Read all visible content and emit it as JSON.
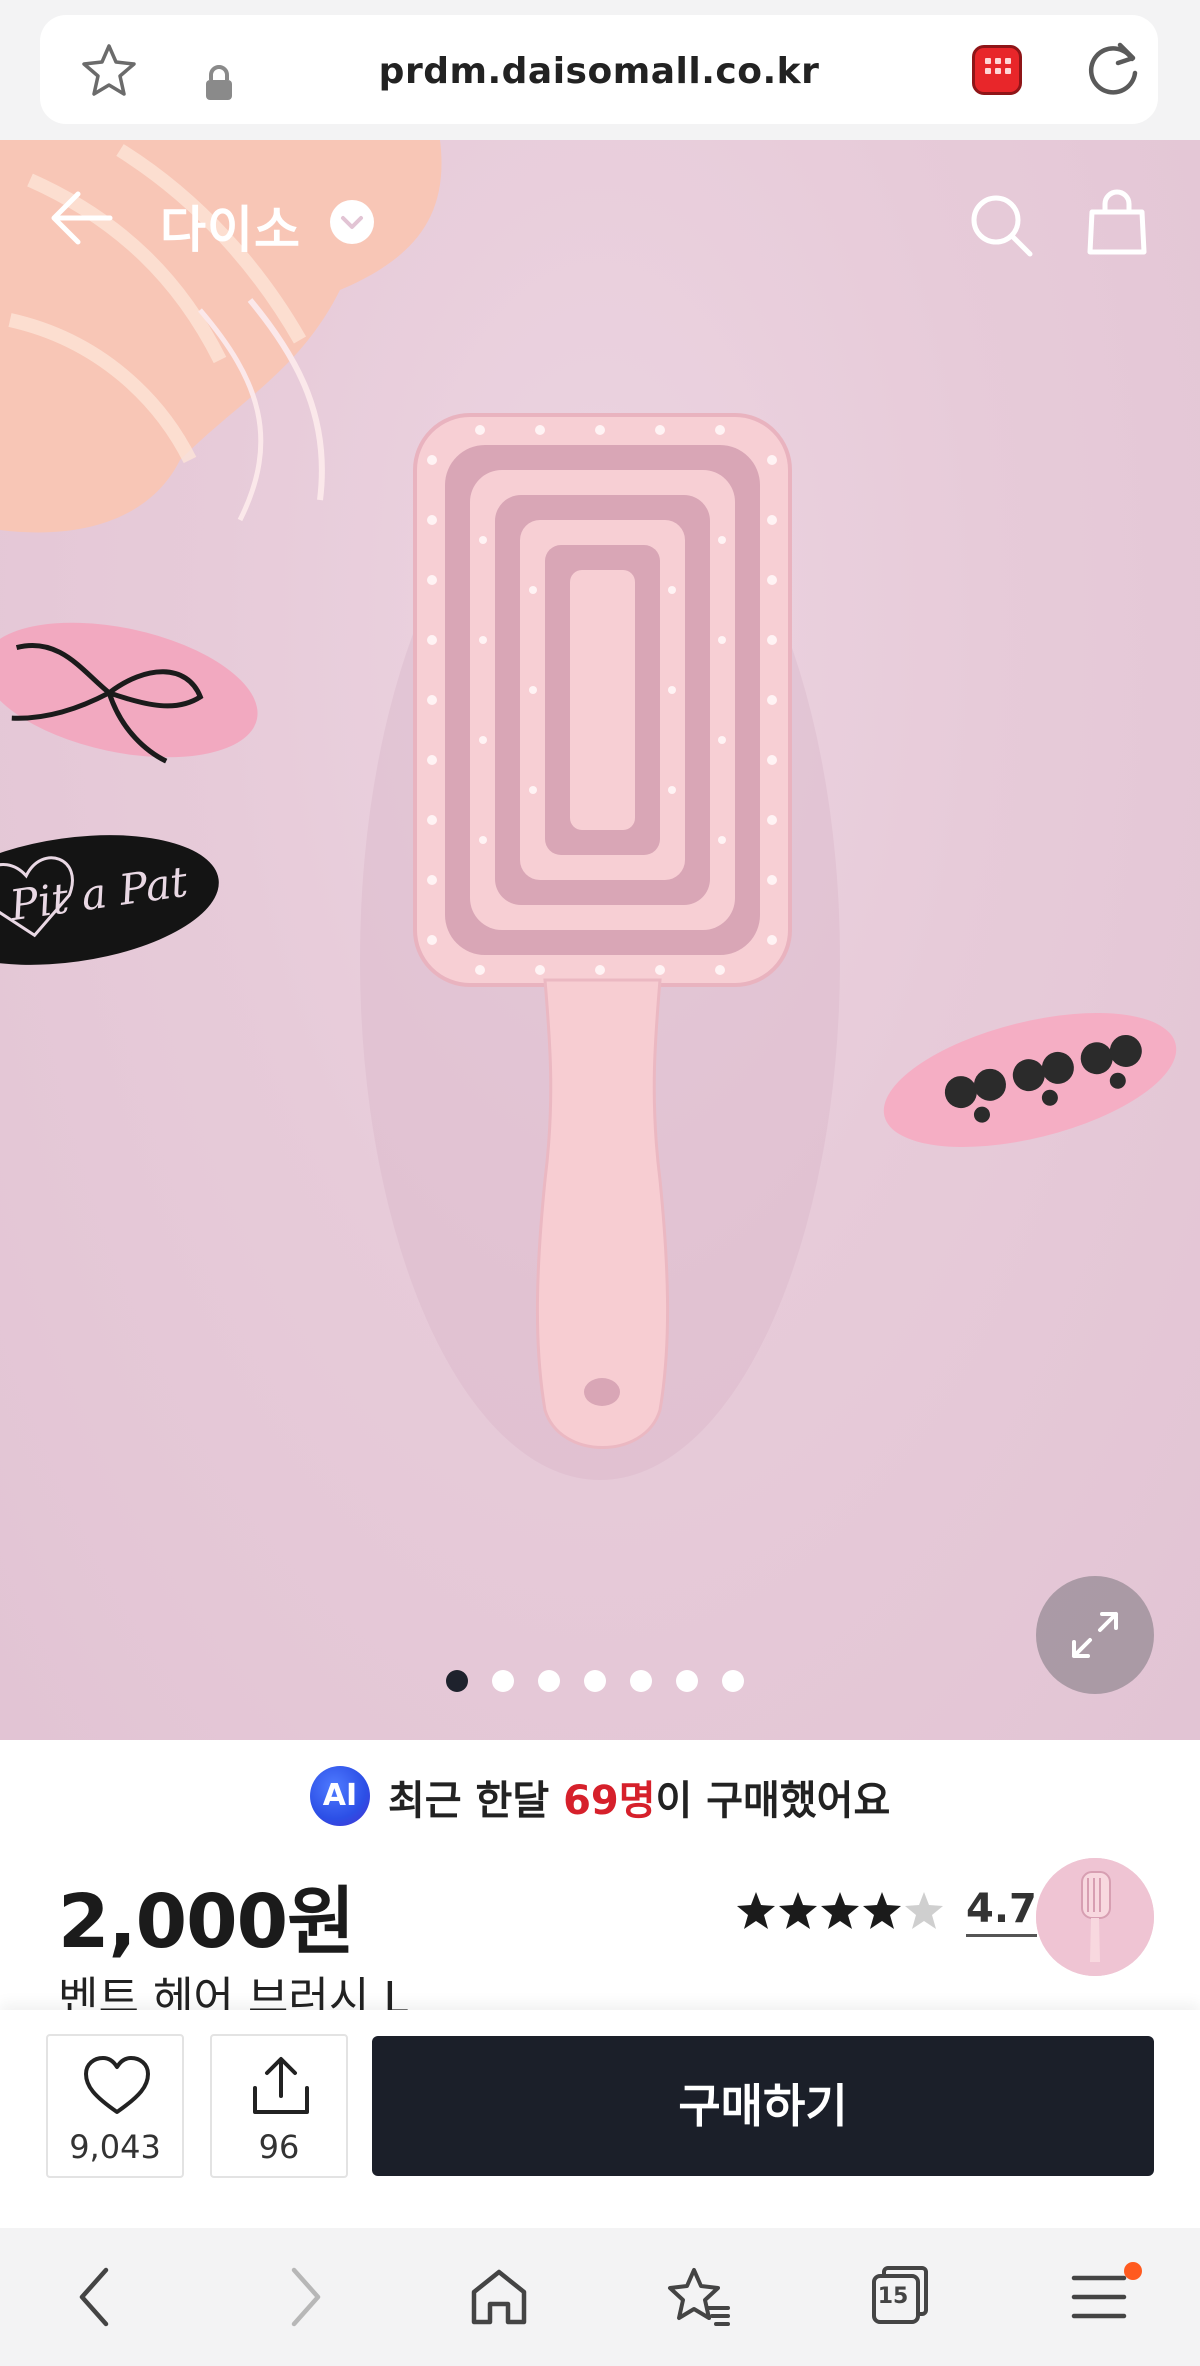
{
  "browser": {
    "url": "prdm.daisomall.co.kr",
    "icons": {
      "favorite": "star-outline-icon",
      "security": "lock-icon",
      "site": "daiso-app-badge-icon",
      "reload": "reload-icon"
    }
  },
  "header": {
    "brand": "다이소",
    "icons": [
      "back-arrow-icon",
      "chevron-down-icon",
      "search-icon",
      "shopping-bag-icon"
    ]
  },
  "gallery": {
    "current_index": 1,
    "total": 7,
    "clip_text": "Pit a Pat",
    "expand_icon": "expand-icon"
  },
  "purchase_info": {
    "ai_badge": "AI",
    "prefix": "최근 한달 ",
    "count": "69명",
    "suffix": "이 구매했어요",
    "highlight_color": "#d6202b"
  },
  "product": {
    "price": "2,000원",
    "rating": "4.7",
    "stars": 4.7,
    "name": "벤트 헤어 브러시 L"
  },
  "actions": {
    "wishlist_count": "9,043",
    "share_count": "96",
    "buy_label": "구매하기",
    "button_color": "#1b1f29"
  },
  "toolbar": {
    "tabs_count": "15",
    "icons": [
      "back-icon",
      "forward-icon",
      "home-icon",
      "bookmarks-icon",
      "tabs-icon",
      "menu-icon"
    ],
    "notification_color": "#ff5a1f"
  }
}
